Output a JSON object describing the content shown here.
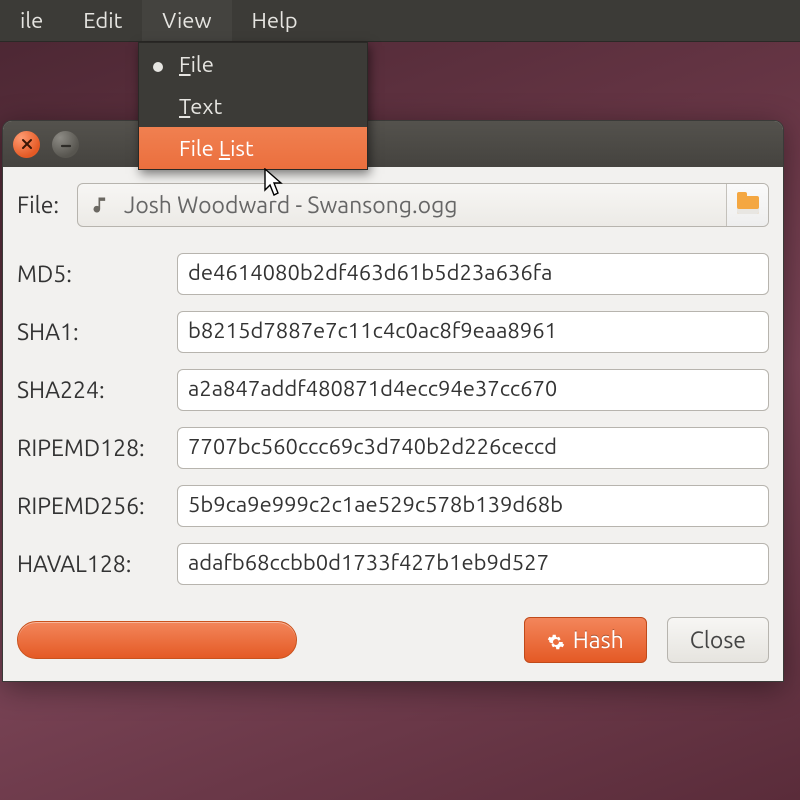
{
  "menubar": {
    "items": [
      {
        "label": "ile"
      },
      {
        "label": "Edit"
      },
      {
        "label": "View"
      },
      {
        "label": "Help"
      }
    ]
  },
  "view_menu": {
    "items": [
      {
        "label_pre": "",
        "label_acc": "F",
        "label_post": "ile",
        "selected": true,
        "highlighted": false
      },
      {
        "label_pre": "",
        "label_acc": "T",
        "label_post": "ext",
        "selected": false,
        "highlighted": false
      },
      {
        "label_pre": "File ",
        "label_acc": "L",
        "label_post": "ist",
        "selected": false,
        "highlighted": true
      }
    ]
  },
  "window": {
    "file_label": "File:",
    "file_name": "Josh Woodward - Swansong.ogg",
    "hashes": [
      {
        "label": "MD5:",
        "value": "de4614080b2df463d61b5d23a636fa"
      },
      {
        "label": "SHA1:",
        "value": "b8215d7887e7c11c4c0ac8f9eaa8961"
      },
      {
        "label": "SHA224:",
        "value": "a2a847addf480871d4ecc94e37cc670"
      },
      {
        "label": "RIPEMD128:",
        "value": "7707bc560ccc69c3d740b2d226ceccd"
      },
      {
        "label": "RIPEMD256:",
        "value": "5b9ca9e999c2c1ae529c578b139d68b"
      },
      {
        "label": "HAVAL128:",
        "value": "adafb68ccbb0d1733f427b1eb9d527"
      }
    ],
    "buttons": {
      "hash": "Hash",
      "close": "Close"
    }
  }
}
